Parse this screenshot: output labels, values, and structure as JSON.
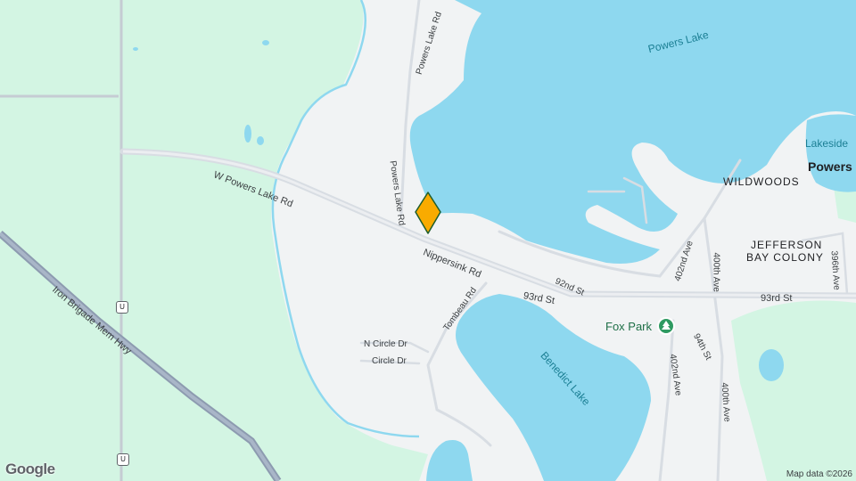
{
  "map": {
    "lakes": {
      "powers_lake": "Powers Lake",
      "benedict_lake": "Benedict Lake",
      "lakeside": "Lakeside"
    },
    "places": {
      "powers": "Powers",
      "wildwoods": "WILDWOODS",
      "jefferson_line1": "JEFFERSON",
      "jefferson_line2": "BAY COLONY",
      "fox_park": "Fox Park"
    },
    "roads": {
      "w_powers_lake_rd": "W Powers Lake Rd",
      "nippersink_rd": "Nippersink Rd",
      "st_93rd_a": "93rd St",
      "st_93rd_b": "93rd St",
      "st_92nd": "92nd St",
      "st_94th": "94th St",
      "powers_lake_rd_north": "Powers Lake Rd",
      "powers_lake_rd_south": "Powers Lake Rd",
      "tombeau_rd": "Tombeau Rd",
      "n_circle_dr": "N Circle Dr",
      "circle_dr": "Circle Dr",
      "ave_402nd_north": "402nd Ave",
      "ave_402nd_south": "402nd Ave",
      "ave_400th_north": "400th Ave",
      "ave_400th_south": "400th Ave",
      "ave_396th": "396th Ave",
      "iron_brigade": "Iron Brigade Mem Hwy"
    },
    "shields": {
      "u_upper": "U",
      "u_lower": "U"
    },
    "attribution": "Map data ©2026",
    "logo": "Google",
    "colors": {
      "water": "#8ed8ef",
      "green": "#d3f5e3",
      "land": "#f1f3f4",
      "pin": "#f9ab00",
      "highway": "#8d9bb0"
    }
  }
}
